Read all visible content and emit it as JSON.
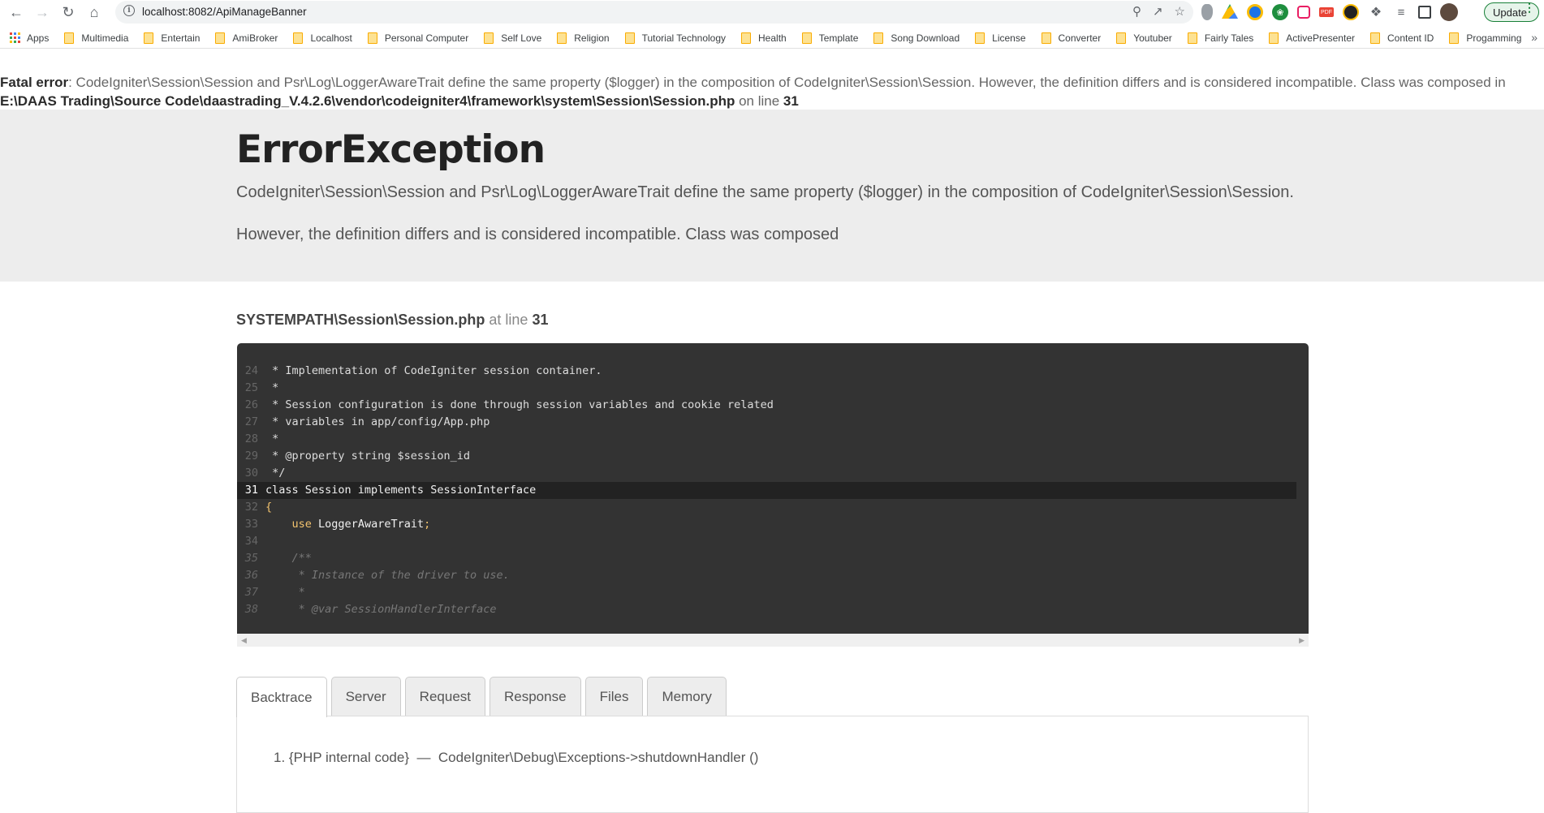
{
  "browser": {
    "url": "localhost:8082/ApiManageBanner",
    "update_label": "Update",
    "bookmarks": [
      "Apps",
      "Multimedia",
      "Entertain",
      "AmiBroker",
      "Localhost",
      "Personal Computer",
      "Self Love",
      "Religion",
      "Tutorial Technology",
      "Health",
      "Template",
      "Song Download",
      "License",
      "Converter",
      "Youtuber",
      "Fairly Tales",
      "ActivePresenter",
      "Content ID",
      "Progamming"
    ],
    "extensions": [
      "shield-extension",
      "google-drive",
      "compass-extension",
      "leaf-extension",
      "video-extension",
      "pdf-extension",
      "kayak-extension",
      "puzzle-extensions",
      "media-control",
      "side-panel",
      "profile-avatar"
    ]
  },
  "fatal": {
    "label": "Fatal error",
    "message": ": CodeIgniter\\Session\\Session and Psr\\Log\\LoggerAwareTrait define the same property ($logger) in the composition of CodeIgniter\\Session\\Session. However, the definition differs and is considered incompatible. Class was composed in ",
    "path": "E:\\DAAS Trading\\Source Code\\daastrading_V.4.2.6\\vendor\\codeigniter4\\framework\\system\\Session\\Session.php",
    "on_line_text": " on line ",
    "line": "31"
  },
  "exception": {
    "title": "ErrorException",
    "message_line1": "CodeIgniter\\Session\\Session and Psr\\Log\\LoggerAwareTrait define the same property ($logger) in the composition of CodeIgniter\\Session\\Session.",
    "message_line2": "However, the definition differs and is considered incompatible. Class was composed"
  },
  "source": {
    "file": "SYSTEMPATH\\Session\\Session.php",
    "at_line_text": " at line ",
    "line": "31",
    "highlight_line": 31,
    "code": [
      {
        "n": "24",
        "text": " * Implementation of CodeIgniter session container.",
        "type": "comment"
      },
      {
        "n": "25",
        "text": " *",
        "type": "comment"
      },
      {
        "n": "26",
        "text": " * Session configuration is done through session variables and cookie related",
        "type": "comment"
      },
      {
        "n": "27",
        "text": " * variables in app/config/App.php",
        "type": "comment"
      },
      {
        "n": "28",
        "text": " *",
        "type": "comment"
      },
      {
        "n": "29",
        "text": " * @property string $session_id",
        "type": "comment"
      },
      {
        "n": "30",
        "text": " */",
        "type": "comment"
      },
      {
        "n": "31",
        "text": "class Session implements SessionInterface",
        "type": "plain"
      },
      {
        "n": "32",
        "text": "{",
        "type": "kw"
      },
      {
        "n": "33",
        "text": "    use LoggerAwareTrait;",
        "type": "use"
      },
      {
        "n": "34",
        "text": "",
        "type": "plain"
      },
      {
        "n": "35",
        "text": "    /**",
        "type": "doc"
      },
      {
        "n": "36",
        "text": "     * Instance of the driver to use.",
        "type": "doc"
      },
      {
        "n": "37",
        "text": "     *",
        "type": "doc"
      },
      {
        "n": "38",
        "text": "     * @var SessionHandlerInterface",
        "type": "doc"
      }
    ]
  },
  "tabs": [
    "Backtrace",
    "Server",
    "Request",
    "Response",
    "Files",
    "Memory"
  ],
  "active_tab": "Backtrace",
  "backtrace": [
    {
      "index": "1.",
      "location": "{PHP internal code}",
      "separator": "—",
      "call": "CodeIgniter\\Debug\\Exceptions->shutdownHandler ()"
    }
  ]
}
